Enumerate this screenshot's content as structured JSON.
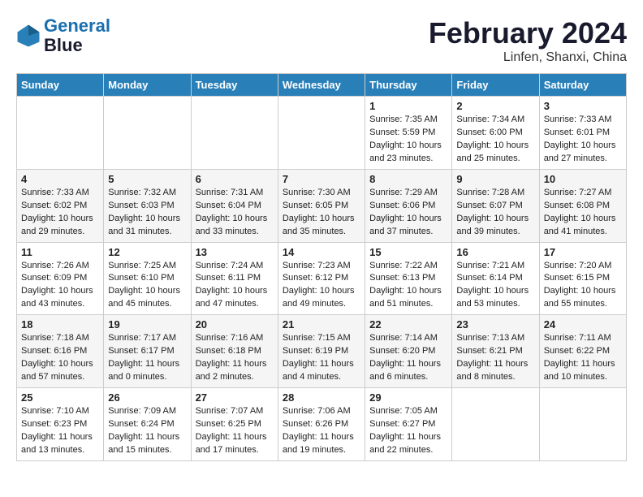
{
  "header": {
    "logo_line1": "General",
    "logo_line2": "Blue",
    "title": "February 2024",
    "subtitle": "Linfen, Shanxi, China"
  },
  "weekdays": [
    "Sunday",
    "Monday",
    "Tuesday",
    "Wednesday",
    "Thursday",
    "Friday",
    "Saturday"
  ],
  "weeks": [
    [
      {
        "day": "",
        "info": ""
      },
      {
        "day": "",
        "info": ""
      },
      {
        "day": "",
        "info": ""
      },
      {
        "day": "",
        "info": ""
      },
      {
        "day": "1",
        "info": "Sunrise: 7:35 AM\nSunset: 5:59 PM\nDaylight: 10 hours\nand 23 minutes."
      },
      {
        "day": "2",
        "info": "Sunrise: 7:34 AM\nSunset: 6:00 PM\nDaylight: 10 hours\nand 25 minutes."
      },
      {
        "day": "3",
        "info": "Sunrise: 7:33 AM\nSunset: 6:01 PM\nDaylight: 10 hours\nand 27 minutes."
      }
    ],
    [
      {
        "day": "4",
        "info": "Sunrise: 7:33 AM\nSunset: 6:02 PM\nDaylight: 10 hours\nand 29 minutes."
      },
      {
        "day": "5",
        "info": "Sunrise: 7:32 AM\nSunset: 6:03 PM\nDaylight: 10 hours\nand 31 minutes."
      },
      {
        "day": "6",
        "info": "Sunrise: 7:31 AM\nSunset: 6:04 PM\nDaylight: 10 hours\nand 33 minutes."
      },
      {
        "day": "7",
        "info": "Sunrise: 7:30 AM\nSunset: 6:05 PM\nDaylight: 10 hours\nand 35 minutes."
      },
      {
        "day": "8",
        "info": "Sunrise: 7:29 AM\nSunset: 6:06 PM\nDaylight: 10 hours\nand 37 minutes."
      },
      {
        "day": "9",
        "info": "Sunrise: 7:28 AM\nSunset: 6:07 PM\nDaylight: 10 hours\nand 39 minutes."
      },
      {
        "day": "10",
        "info": "Sunrise: 7:27 AM\nSunset: 6:08 PM\nDaylight: 10 hours\nand 41 minutes."
      }
    ],
    [
      {
        "day": "11",
        "info": "Sunrise: 7:26 AM\nSunset: 6:09 PM\nDaylight: 10 hours\nand 43 minutes."
      },
      {
        "day": "12",
        "info": "Sunrise: 7:25 AM\nSunset: 6:10 PM\nDaylight: 10 hours\nand 45 minutes."
      },
      {
        "day": "13",
        "info": "Sunrise: 7:24 AM\nSunset: 6:11 PM\nDaylight: 10 hours\nand 47 minutes."
      },
      {
        "day": "14",
        "info": "Sunrise: 7:23 AM\nSunset: 6:12 PM\nDaylight: 10 hours\nand 49 minutes."
      },
      {
        "day": "15",
        "info": "Sunrise: 7:22 AM\nSunset: 6:13 PM\nDaylight: 10 hours\nand 51 minutes."
      },
      {
        "day": "16",
        "info": "Sunrise: 7:21 AM\nSunset: 6:14 PM\nDaylight: 10 hours\nand 53 minutes."
      },
      {
        "day": "17",
        "info": "Sunrise: 7:20 AM\nSunset: 6:15 PM\nDaylight: 10 hours\nand 55 minutes."
      }
    ],
    [
      {
        "day": "18",
        "info": "Sunrise: 7:18 AM\nSunset: 6:16 PM\nDaylight: 10 hours\nand 57 minutes."
      },
      {
        "day": "19",
        "info": "Sunrise: 7:17 AM\nSunset: 6:17 PM\nDaylight: 11 hours\nand 0 minutes."
      },
      {
        "day": "20",
        "info": "Sunrise: 7:16 AM\nSunset: 6:18 PM\nDaylight: 11 hours\nand 2 minutes."
      },
      {
        "day": "21",
        "info": "Sunrise: 7:15 AM\nSunset: 6:19 PM\nDaylight: 11 hours\nand 4 minutes."
      },
      {
        "day": "22",
        "info": "Sunrise: 7:14 AM\nSunset: 6:20 PM\nDaylight: 11 hours\nand 6 minutes."
      },
      {
        "day": "23",
        "info": "Sunrise: 7:13 AM\nSunset: 6:21 PM\nDaylight: 11 hours\nand 8 minutes."
      },
      {
        "day": "24",
        "info": "Sunrise: 7:11 AM\nSunset: 6:22 PM\nDaylight: 11 hours\nand 10 minutes."
      }
    ],
    [
      {
        "day": "25",
        "info": "Sunrise: 7:10 AM\nSunset: 6:23 PM\nDaylight: 11 hours\nand 13 minutes."
      },
      {
        "day": "26",
        "info": "Sunrise: 7:09 AM\nSunset: 6:24 PM\nDaylight: 11 hours\nand 15 minutes."
      },
      {
        "day": "27",
        "info": "Sunrise: 7:07 AM\nSunset: 6:25 PM\nDaylight: 11 hours\nand 17 minutes."
      },
      {
        "day": "28",
        "info": "Sunrise: 7:06 AM\nSunset: 6:26 PM\nDaylight: 11 hours\nand 19 minutes."
      },
      {
        "day": "29",
        "info": "Sunrise: 7:05 AM\nSunset: 6:27 PM\nDaylight: 11 hours\nand 22 minutes."
      },
      {
        "day": "",
        "info": ""
      },
      {
        "day": "",
        "info": ""
      }
    ]
  ]
}
